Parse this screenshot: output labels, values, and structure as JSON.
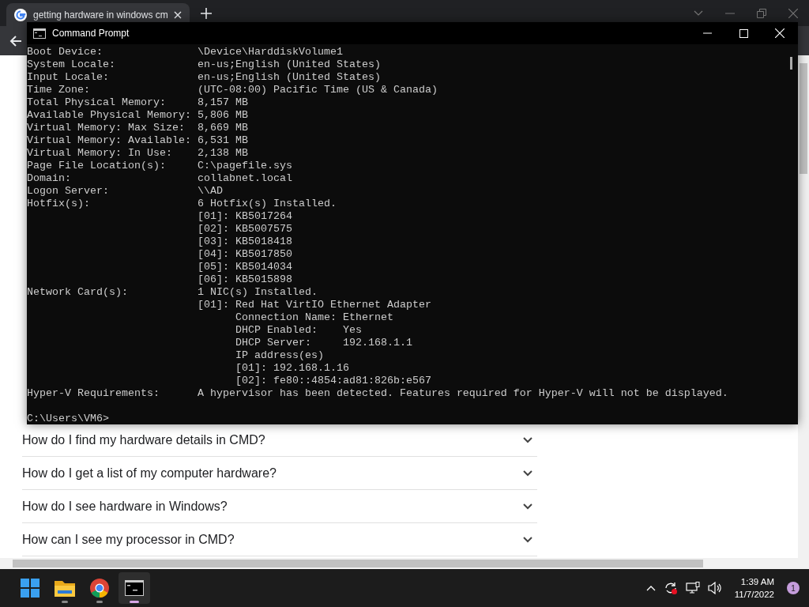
{
  "browser": {
    "tab": {
      "title": "getting hardware in windows cm",
      "selected": true
    }
  },
  "console": {
    "title": "Command Prompt",
    "lines": [
      "Boot Device:               \\Device\\HarddiskVolume1",
      "System Locale:             en-us;English (United States)",
      "Input Locale:              en-us;English (United States)",
      "Time Zone:                 (UTC-08:00) Pacific Time (US & Canada)",
      "Total Physical Memory:     8,157 MB",
      "Available Physical Memory: 5,806 MB",
      "Virtual Memory: Max Size:  8,669 MB",
      "Virtual Memory: Available: 6,531 MB",
      "Virtual Memory: In Use:    2,138 MB",
      "Page File Location(s):     C:\\pagefile.sys",
      "Domain:                    collabnet.local",
      "Logon Server:              \\\\AD",
      "Hotfix(s):                 6 Hotfix(s) Installed.",
      "                           [01]: KB5017264",
      "                           [02]: KB5007575",
      "                           [03]: KB5018418",
      "                           [04]: KB5017850",
      "                           [05]: KB5014034",
      "                           [06]: KB5015898",
      "Network Card(s):           1 NIC(s) Installed.",
      "                           [01]: Red Hat VirtIO Ethernet Adapter",
      "                                 Connection Name: Ethernet",
      "                                 DHCP Enabled:    Yes",
      "                                 DHCP Server:     192.168.1.1",
      "                                 IP address(es)",
      "                                 [01]: 192.168.1.16",
      "                                 [02]: fe80::4854:ad81:826b:e567",
      "Hyper-V Requirements:      A hypervisor has been detected. Features required for Hyper-V will not be displayed."
    ],
    "prompt": "C:\\Users\\VM6>"
  },
  "faq": [
    {
      "question": "How do I find my hardware details in CMD?",
      "expanded": false
    },
    {
      "question": "How do I get a list of my computer hardware?",
      "expanded": false
    },
    {
      "question": "How do I see hardware in Windows?",
      "expanded": false
    },
    {
      "question": "How can I see my processor in CMD?",
      "expanded": false
    }
  ],
  "taskbar": {
    "apps": [
      {
        "kind": "start",
        "selected": false
      },
      {
        "kind": "folder",
        "selected": false
      },
      {
        "kind": "browser",
        "selected": false
      },
      {
        "kind": "terminal",
        "selected": true
      }
    ],
    "time": "1:39 AM",
    "date": "11/7/2022",
    "notifications": "1"
  }
}
